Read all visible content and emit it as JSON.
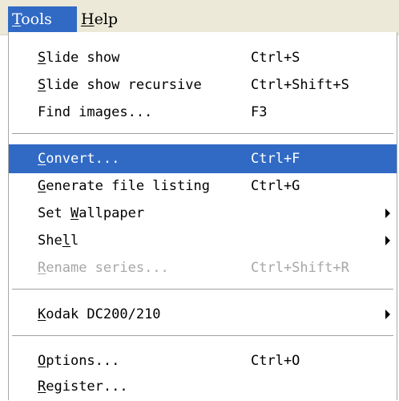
{
  "menubar": {
    "tools": {
      "first": "T",
      "rest": "ools"
    },
    "help": {
      "first": "H",
      "rest": "elp"
    }
  },
  "menu": {
    "items": [
      {
        "key": "S",
        "pre": "",
        "post": "lide show",
        "shortcut": "Ctrl+S",
        "state": "normal"
      },
      {
        "key": "S",
        "pre": "",
        "post": "lide show recursive",
        "shortcut": "Ctrl+Shift+S",
        "state": "normal"
      },
      {
        "key": "",
        "pre": "Find images...",
        "post": "",
        "shortcut": "F3",
        "state": "normal"
      },
      {
        "key": "C",
        "pre": "",
        "post": "onvert...",
        "shortcut": "Ctrl+F",
        "state": "selected"
      },
      {
        "key": "G",
        "pre": "",
        "post": "enerate file listing",
        "shortcut": "Ctrl+G",
        "state": "normal"
      },
      {
        "key": "W",
        "pre": "Set ",
        "post": "allpaper",
        "shortcut": "",
        "state": "submenu"
      },
      {
        "key": "l",
        "pre": "She",
        "post": "l",
        "shortcut": "",
        "state": "submenu"
      },
      {
        "key": "R",
        "pre": "",
        "post": "ename series...",
        "shortcut": "Ctrl+Shift+R",
        "state": "disabled"
      },
      {
        "key": "K",
        "pre": "",
        "post": "odak DC200/210",
        "shortcut": "",
        "state": "submenu"
      },
      {
        "key": "O",
        "pre": "",
        "post": "ptions...",
        "shortcut": "Ctrl+O",
        "state": "normal"
      },
      {
        "key": "R",
        "pre": "",
        "post": "egister...",
        "shortcut": "",
        "state": "normal"
      }
    ]
  },
  "colors": {
    "highlight": "#316ac5",
    "menubar_bg": "#ece9d8",
    "disabled_text": "#a7a7a7"
  }
}
